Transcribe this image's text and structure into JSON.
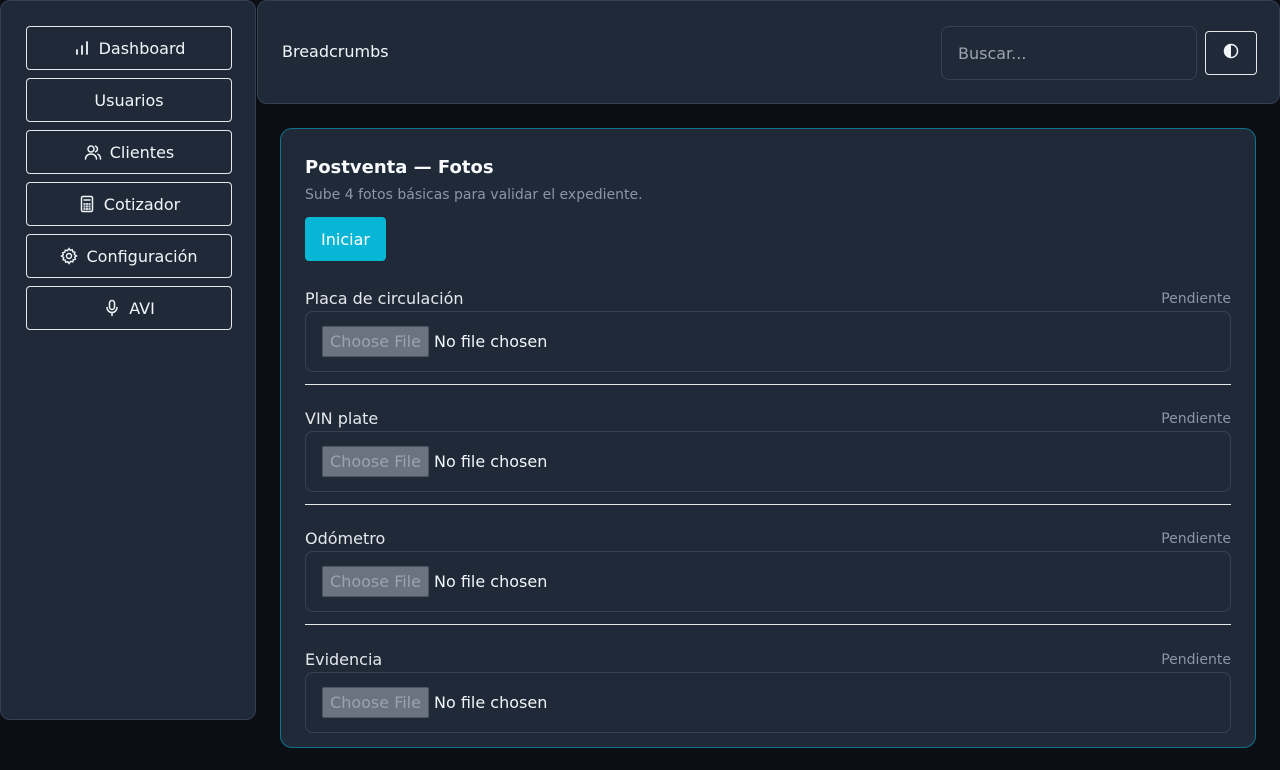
{
  "sidebar": {
    "items": [
      {
        "label": "Dashboard",
        "icon": "bar-chart-icon"
      },
      {
        "label": "Usuarios",
        "icon": ""
      },
      {
        "label": "Clientes",
        "icon": "users-icon"
      },
      {
        "label": "Cotizador",
        "icon": "calculator-icon"
      },
      {
        "label": "Configuración",
        "icon": "gear-icon"
      },
      {
        "label": "AVI",
        "icon": "microphone-icon"
      }
    ]
  },
  "header": {
    "breadcrumbs": "Breadcrumbs",
    "search_placeholder": "Buscar...",
    "theme_toggle_icon": "contrast-icon"
  },
  "card": {
    "title": "Postventa — Fotos",
    "subtitle": "Sube 4 fotos básicas para validar el expediente.",
    "start_label": "Iniciar",
    "photos": [
      {
        "label": "Placa de circulación",
        "status": "Pendiente",
        "choose_label": "Choose File",
        "file_status": "No file chosen"
      },
      {
        "label": "VIN plate",
        "status": "Pendiente",
        "choose_label": "Choose File",
        "file_status": "No file chosen"
      },
      {
        "label": "Odómetro",
        "status": "Pendiente",
        "choose_label": "Choose File",
        "file_status": "No file chosen"
      },
      {
        "label": "Evidencia",
        "status": "Pendiente",
        "choose_label": "Choose File",
        "file_status": "No file chosen"
      }
    ]
  },
  "colors": {
    "accent": "#06b6d4",
    "panel": "#1f2937",
    "background": "#0b0f14"
  }
}
